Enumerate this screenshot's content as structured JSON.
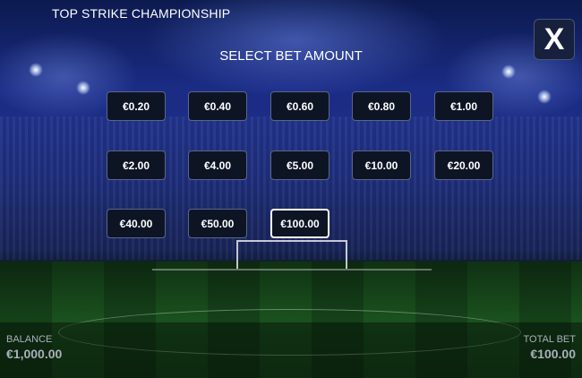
{
  "game": {
    "title": "TOP STRIKE CHAMPIONSHIP"
  },
  "close": {
    "label": "X"
  },
  "selector": {
    "heading": "SELECT BET AMOUNT",
    "selected": "€100.00",
    "options": [
      "€0.20",
      "€0.40",
      "€0.60",
      "€0.80",
      "€1.00",
      "€2.00",
      "€4.00",
      "€5.00",
      "€10.00",
      "€20.00",
      "€40.00",
      "€50.00",
      "€100.00"
    ]
  },
  "footer": {
    "balance_label": "BALANCE",
    "balance_value": "€1,000.00",
    "total_bet_label": "TOTAL BET",
    "total_bet_value": "€100.00"
  }
}
